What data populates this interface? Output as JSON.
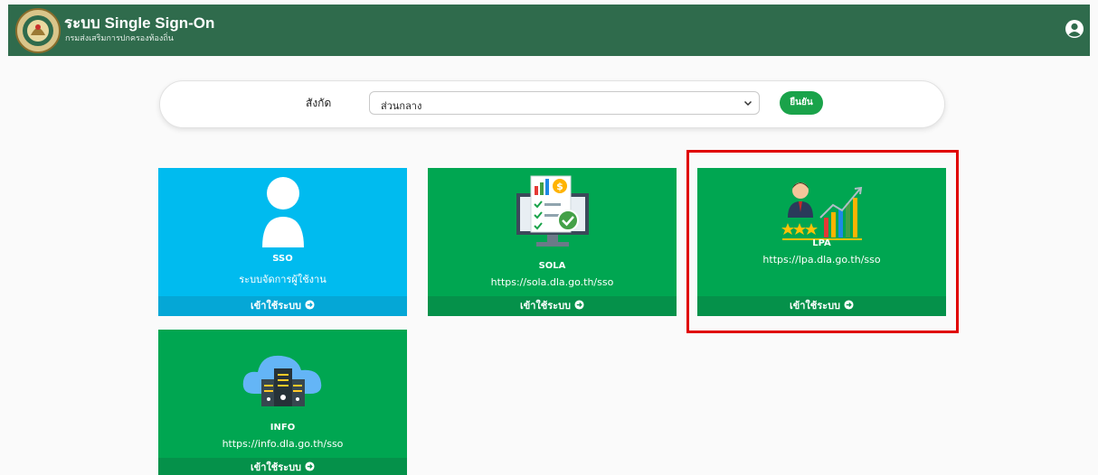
{
  "header": {
    "title": "ระบบ Single Sign-On",
    "subtitle": "กรมส่งเสริมการปกครองท้องถิ่น",
    "logo_icon": "dla-seal-icon",
    "user_icon": "user-circle-icon"
  },
  "filter": {
    "label": "สังกัด",
    "selected": "ส่วนกลาง",
    "confirm_label": "ยืนยัน"
  },
  "cards": [
    {
      "title": "SSO",
      "subtitle": "ระบบจัดการผู้ใช้งาน",
      "action": "เข้าใช้ระบบ",
      "icon": "user-silhouette-icon"
    },
    {
      "title": "SOLA",
      "subtitle": "https://sola.dla.go.th/sso",
      "action": "เข้าใช้ระบบ",
      "icon": "monitor-checklist-icon"
    },
    {
      "title": "LPA",
      "subtitle": "https://lpa.dla.go.th/sso",
      "action": "เข้าใช้ระบบ",
      "icon": "businessman-chart-icon"
    },
    {
      "title": "INFO",
      "subtitle": "https://info.dla.go.th/sso",
      "action": "เข้าใช้ระบบ",
      "icon": "cloud-server-icon"
    }
  ],
  "colors": {
    "header": "#2f6b4c",
    "sso_card": "#00bbef",
    "green_card": "#00a651",
    "confirm": "#1aa34a",
    "highlight": "#e00000"
  }
}
